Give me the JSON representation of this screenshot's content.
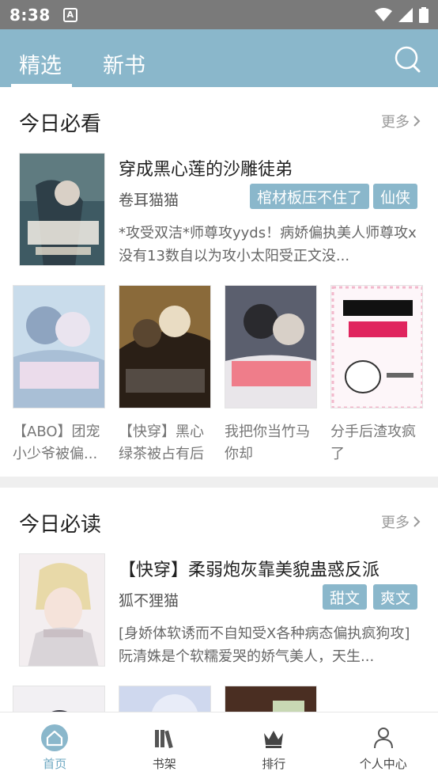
{
  "status_bar": {
    "time": "8:38",
    "app_icon_letter": "A"
  },
  "header": {
    "tabs": [
      {
        "label": "精选",
        "selected": true
      },
      {
        "label": "新书",
        "selected": false
      }
    ],
    "accent_color": "#8ab7cb"
  },
  "section1": {
    "title": "今日必看",
    "more_label": "更多",
    "featured": {
      "title": "穿成黑心莲的沙雕徒弟",
      "author": "卷耳猫猫",
      "tags": [
        "棺材板压不住了",
        "仙侠"
      ],
      "description": "*攻受双洁*师尊攻yyds！病娇偏执美人师尊攻x没有13数自以为攻小太阳受正文没..."
    },
    "grid": [
      {
        "title": "【ABO】团宠小少爷被偏..."
      },
      {
        "title": "【快穿】黑心绿茶被占有后"
      },
      {
        "title": "我把你当竹马你却"
      },
      {
        "title": "分手后渣攻疯了"
      }
    ]
  },
  "section2": {
    "title": "今日必读",
    "more_label": "更多",
    "featured": {
      "title": "【快穿】柔弱炮灰靠美貌蛊惑反派",
      "author": "狐不狸猫",
      "tags": [
        "甜文",
        "爽文"
      ],
      "description": "[身娇体软诱而不自知受X各种病态偏执疯狗攻]阮清姝是个软糯爱哭的娇气美人，天生..."
    }
  },
  "bottom_nav": [
    {
      "label": "首页",
      "icon": "home-icon",
      "active": true
    },
    {
      "label": "书架",
      "icon": "bookshelf-icon",
      "active": false
    },
    {
      "label": "排行",
      "icon": "crown-icon",
      "active": false
    },
    {
      "label": "个人中心",
      "icon": "person-icon",
      "active": false
    }
  ]
}
